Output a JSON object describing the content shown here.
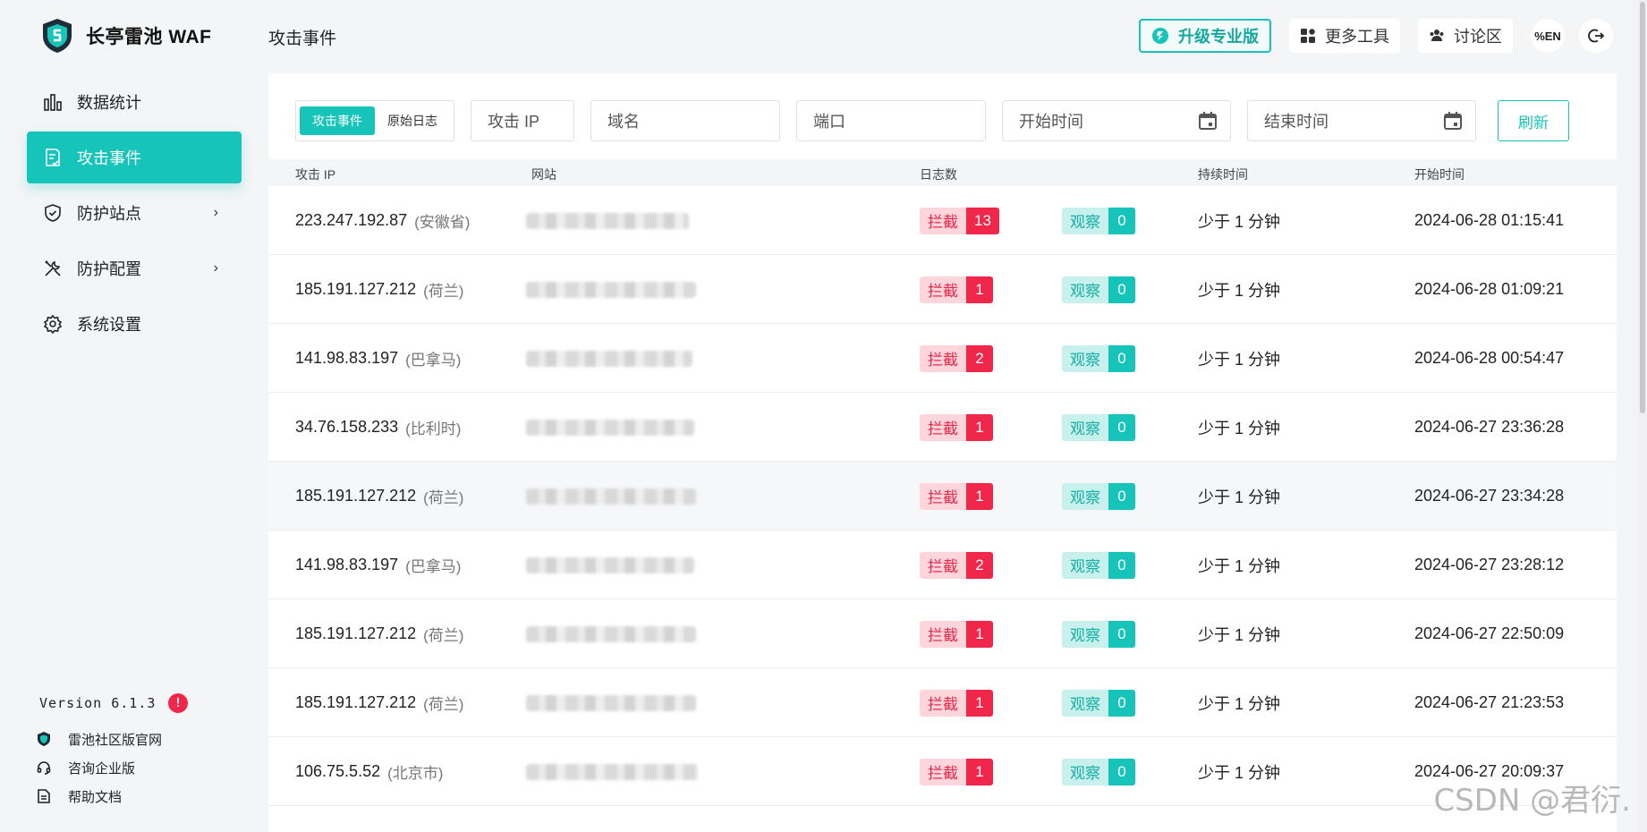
{
  "app": {
    "name": "长亭雷池 WAF"
  },
  "header": {
    "page_title": "攻击事件",
    "upgrade_label": "升级专业版",
    "tools_label": "更多工具",
    "forum_label": "讨论区",
    "lang_label": "%EN"
  },
  "sidebar": {
    "items": [
      {
        "label": "数据统计",
        "icon": "bar-chart-icon"
      },
      {
        "label": "攻击事件",
        "icon": "document-check-icon",
        "active": true
      },
      {
        "label": "防护站点",
        "icon": "shield-icon",
        "has_children": true
      },
      {
        "label": "防护配置",
        "icon": "tools-icon",
        "has_children": true
      },
      {
        "label": "系统设置",
        "icon": "gear-icon"
      }
    ],
    "version": "Version 6.1.3",
    "version_badge": "!",
    "links": [
      {
        "label": "雷池社区版官网",
        "icon": "shield-logo-icon"
      },
      {
        "label": "咨询企业版",
        "icon": "headset-icon"
      },
      {
        "label": "帮助文档",
        "icon": "doc-icon"
      }
    ]
  },
  "filters": {
    "seg_events": "攻击事件",
    "seg_logs": "原始日志",
    "ip_placeholder": "攻击 IP",
    "domain_placeholder": "域名",
    "port_placeholder": "端口",
    "start_placeholder": "开始时间",
    "end_placeholder": "结束时间",
    "refresh_label": "刷新"
  },
  "table": {
    "columns": [
      "攻击 IP",
      "网站",
      "日志数",
      "持续时间",
      "开始时间"
    ],
    "block_label": "拦截",
    "watch_label": "观察",
    "rows": [
      {
        "ip": "223.247.192.87",
        "loc": "(安徽省)",
        "block": "13",
        "watch": "0",
        "duration": "少于 1 分钟",
        "time": "2024-06-28 01:15:41"
      },
      {
        "ip": "185.191.127.212",
        "loc": "(荷兰)",
        "block": "1",
        "watch": "0",
        "duration": "少于 1 分钟",
        "time": "2024-06-28 01:09:21"
      },
      {
        "ip": "141.98.83.197",
        "loc": "(巴拿马)",
        "block": "2",
        "watch": "0",
        "duration": "少于 1 分钟",
        "time": "2024-06-28 00:54:47"
      },
      {
        "ip": "34.76.158.233",
        "loc": "(比利时)",
        "block": "1",
        "watch": "0",
        "duration": "少于 1 分钟",
        "time": "2024-06-27 23:36:28"
      },
      {
        "ip": "185.191.127.212",
        "loc": "(荷兰)",
        "block": "1",
        "watch": "0",
        "duration": "少于 1 分钟",
        "time": "2024-06-27 23:34:28"
      },
      {
        "ip": "141.98.83.197",
        "loc": "(巴拿马)",
        "block": "2",
        "watch": "0",
        "duration": "少于 1 分钟",
        "time": "2024-06-27 23:28:12"
      },
      {
        "ip": "185.191.127.212",
        "loc": "(荷兰)",
        "block": "1",
        "watch": "0",
        "duration": "少于 1 分钟",
        "time": "2024-06-27 22:50:09"
      },
      {
        "ip": "185.191.127.212",
        "loc": "(荷兰)",
        "block": "1",
        "watch": "0",
        "duration": "少于 1 分钟",
        "time": "2024-06-27 21:23:53"
      },
      {
        "ip": "106.75.5.52",
        "loc": "(北京市)",
        "block": "1",
        "watch": "0",
        "duration": "少于 1 分钟",
        "time": "2024-06-27 20:09:37"
      }
    ]
  },
  "watermark": "CSDN @君衍.",
  "colors": {
    "accent": "#16c4b9",
    "danger": "#f0274a",
    "bg": "#f3f5f7"
  }
}
